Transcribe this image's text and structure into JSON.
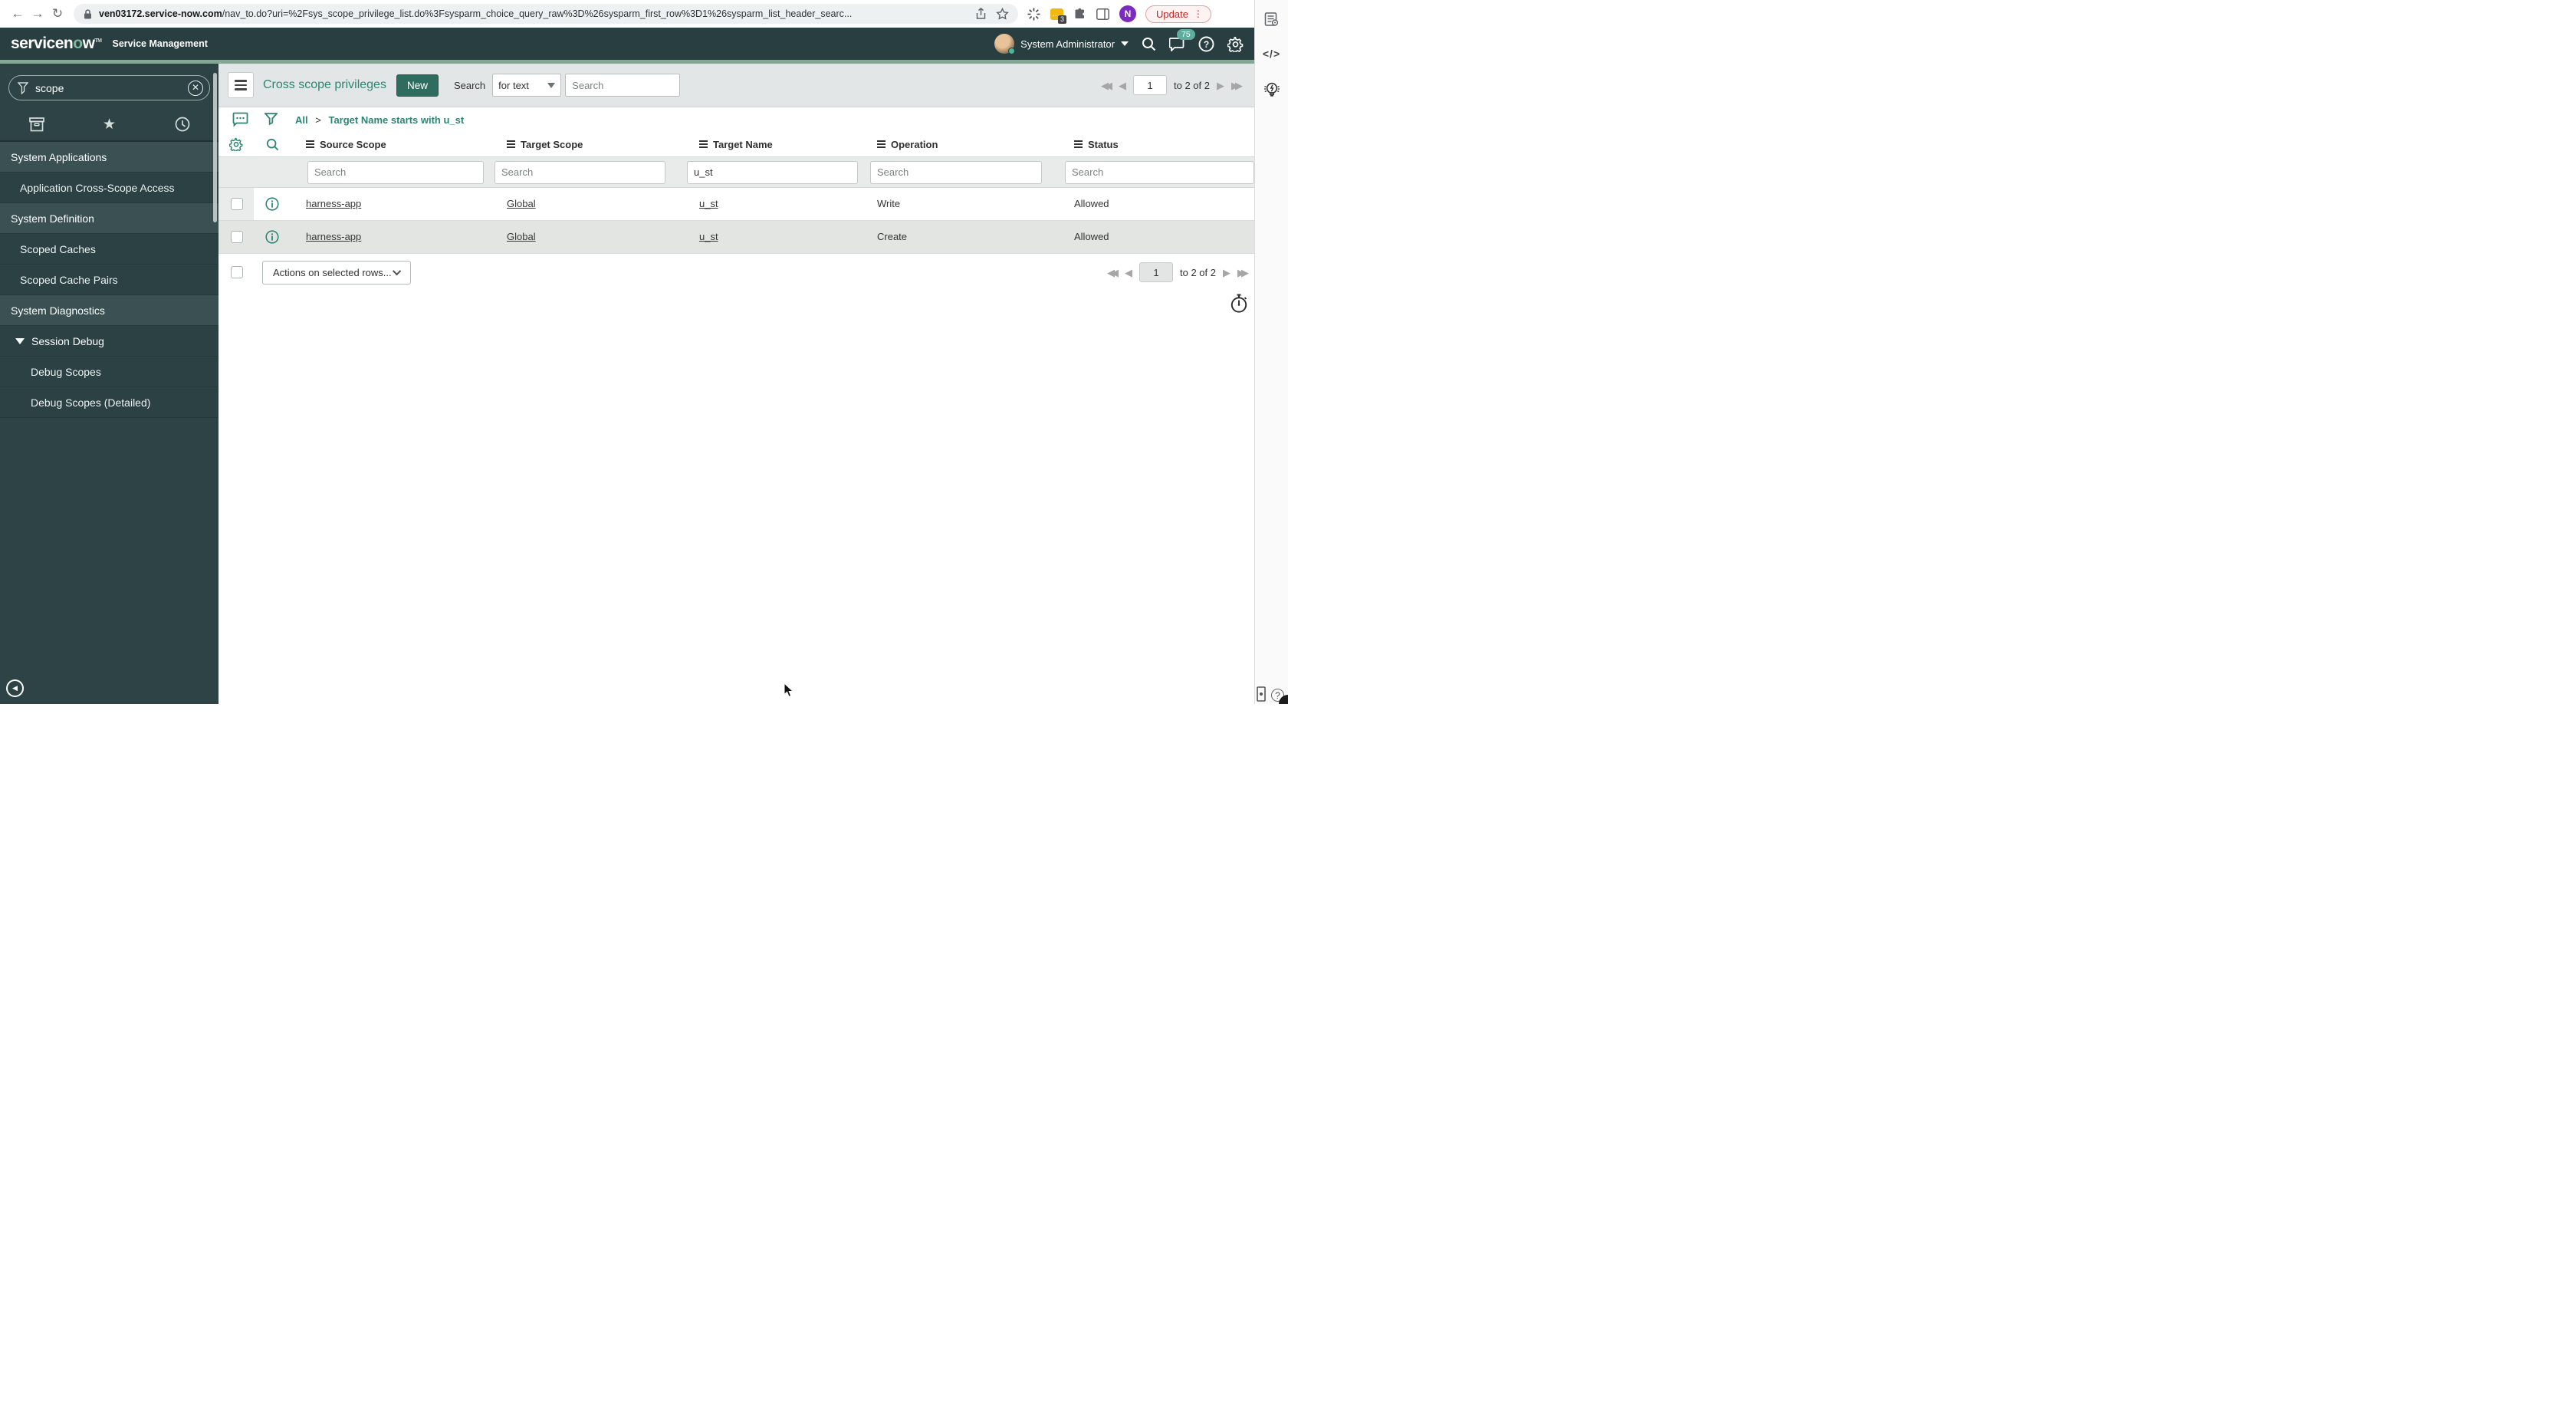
{
  "browser": {
    "url_domain": "ven03172.service-now.com",
    "url_path": "/nav_to.do?uri=%2Fsys_scope_privilege_list.do%3Fsysparm_choice_query_raw%3D%26sysparm_first_row%3D1%26sysparm_list_header_searc...",
    "extension_badge": "3",
    "profile_initial": "N",
    "update_label": "Update"
  },
  "header": {
    "logo_pre": "servicen",
    "logo_o": "o",
    "logo_post": "w",
    "product": "Service Management",
    "user_name": "System Administrator",
    "notification_count": "75"
  },
  "sidebar": {
    "filter_value": "scope",
    "items": [
      {
        "label": "System Applications",
        "type": "app"
      },
      {
        "label": "Application Cross-Scope Access",
        "type": "module"
      },
      {
        "label": "System Definition",
        "type": "app"
      },
      {
        "label": "Scoped Caches",
        "type": "module"
      },
      {
        "label": "Scoped Cache Pairs",
        "type": "module"
      },
      {
        "label": "System Diagnostics",
        "type": "app"
      },
      {
        "label": "Session Debug",
        "type": "expanded"
      },
      {
        "label": "Debug Scopes",
        "type": "sub"
      },
      {
        "label": "Debug Scopes (Detailed)",
        "type": "sub"
      }
    ]
  },
  "list": {
    "title": "Cross scope privileges",
    "new_button": "New",
    "search_label": "Search",
    "search_type": "for text",
    "search_placeholder": "Search",
    "breadcrumb": {
      "root": "All",
      "sep": ">",
      "filter": "Target Name starts with u_st"
    },
    "pagination": {
      "page": "1",
      "range": "to 2 of 2"
    },
    "columns": [
      "Source Scope",
      "Target Scope",
      "Target Name",
      "Operation",
      "Status"
    ],
    "filter_values": {
      "source_scope": "",
      "target_scope": "",
      "target_name": "u_st",
      "operation": "",
      "status": ""
    },
    "rows": [
      {
        "source_scope": "harness-app",
        "target_scope": "Global",
        "target_name": "u_st",
        "operation": "Write",
        "status": "Allowed"
      },
      {
        "source_scope": "harness-app",
        "target_scope": "Global",
        "target_name": "u_st",
        "operation": "Create",
        "status": "Allowed"
      }
    ],
    "actions_label": "Actions on selected rows..."
  },
  "rail": {
    "code_label": "</>"
  },
  "colors": {
    "accent_teal": "#2e8575",
    "header_bg": "#293e40",
    "sidebar_bg": "#2e4345",
    "new_button_bg": "#2e6c60",
    "update_red": "#c5221f",
    "badge_teal": "#5fae9d"
  }
}
